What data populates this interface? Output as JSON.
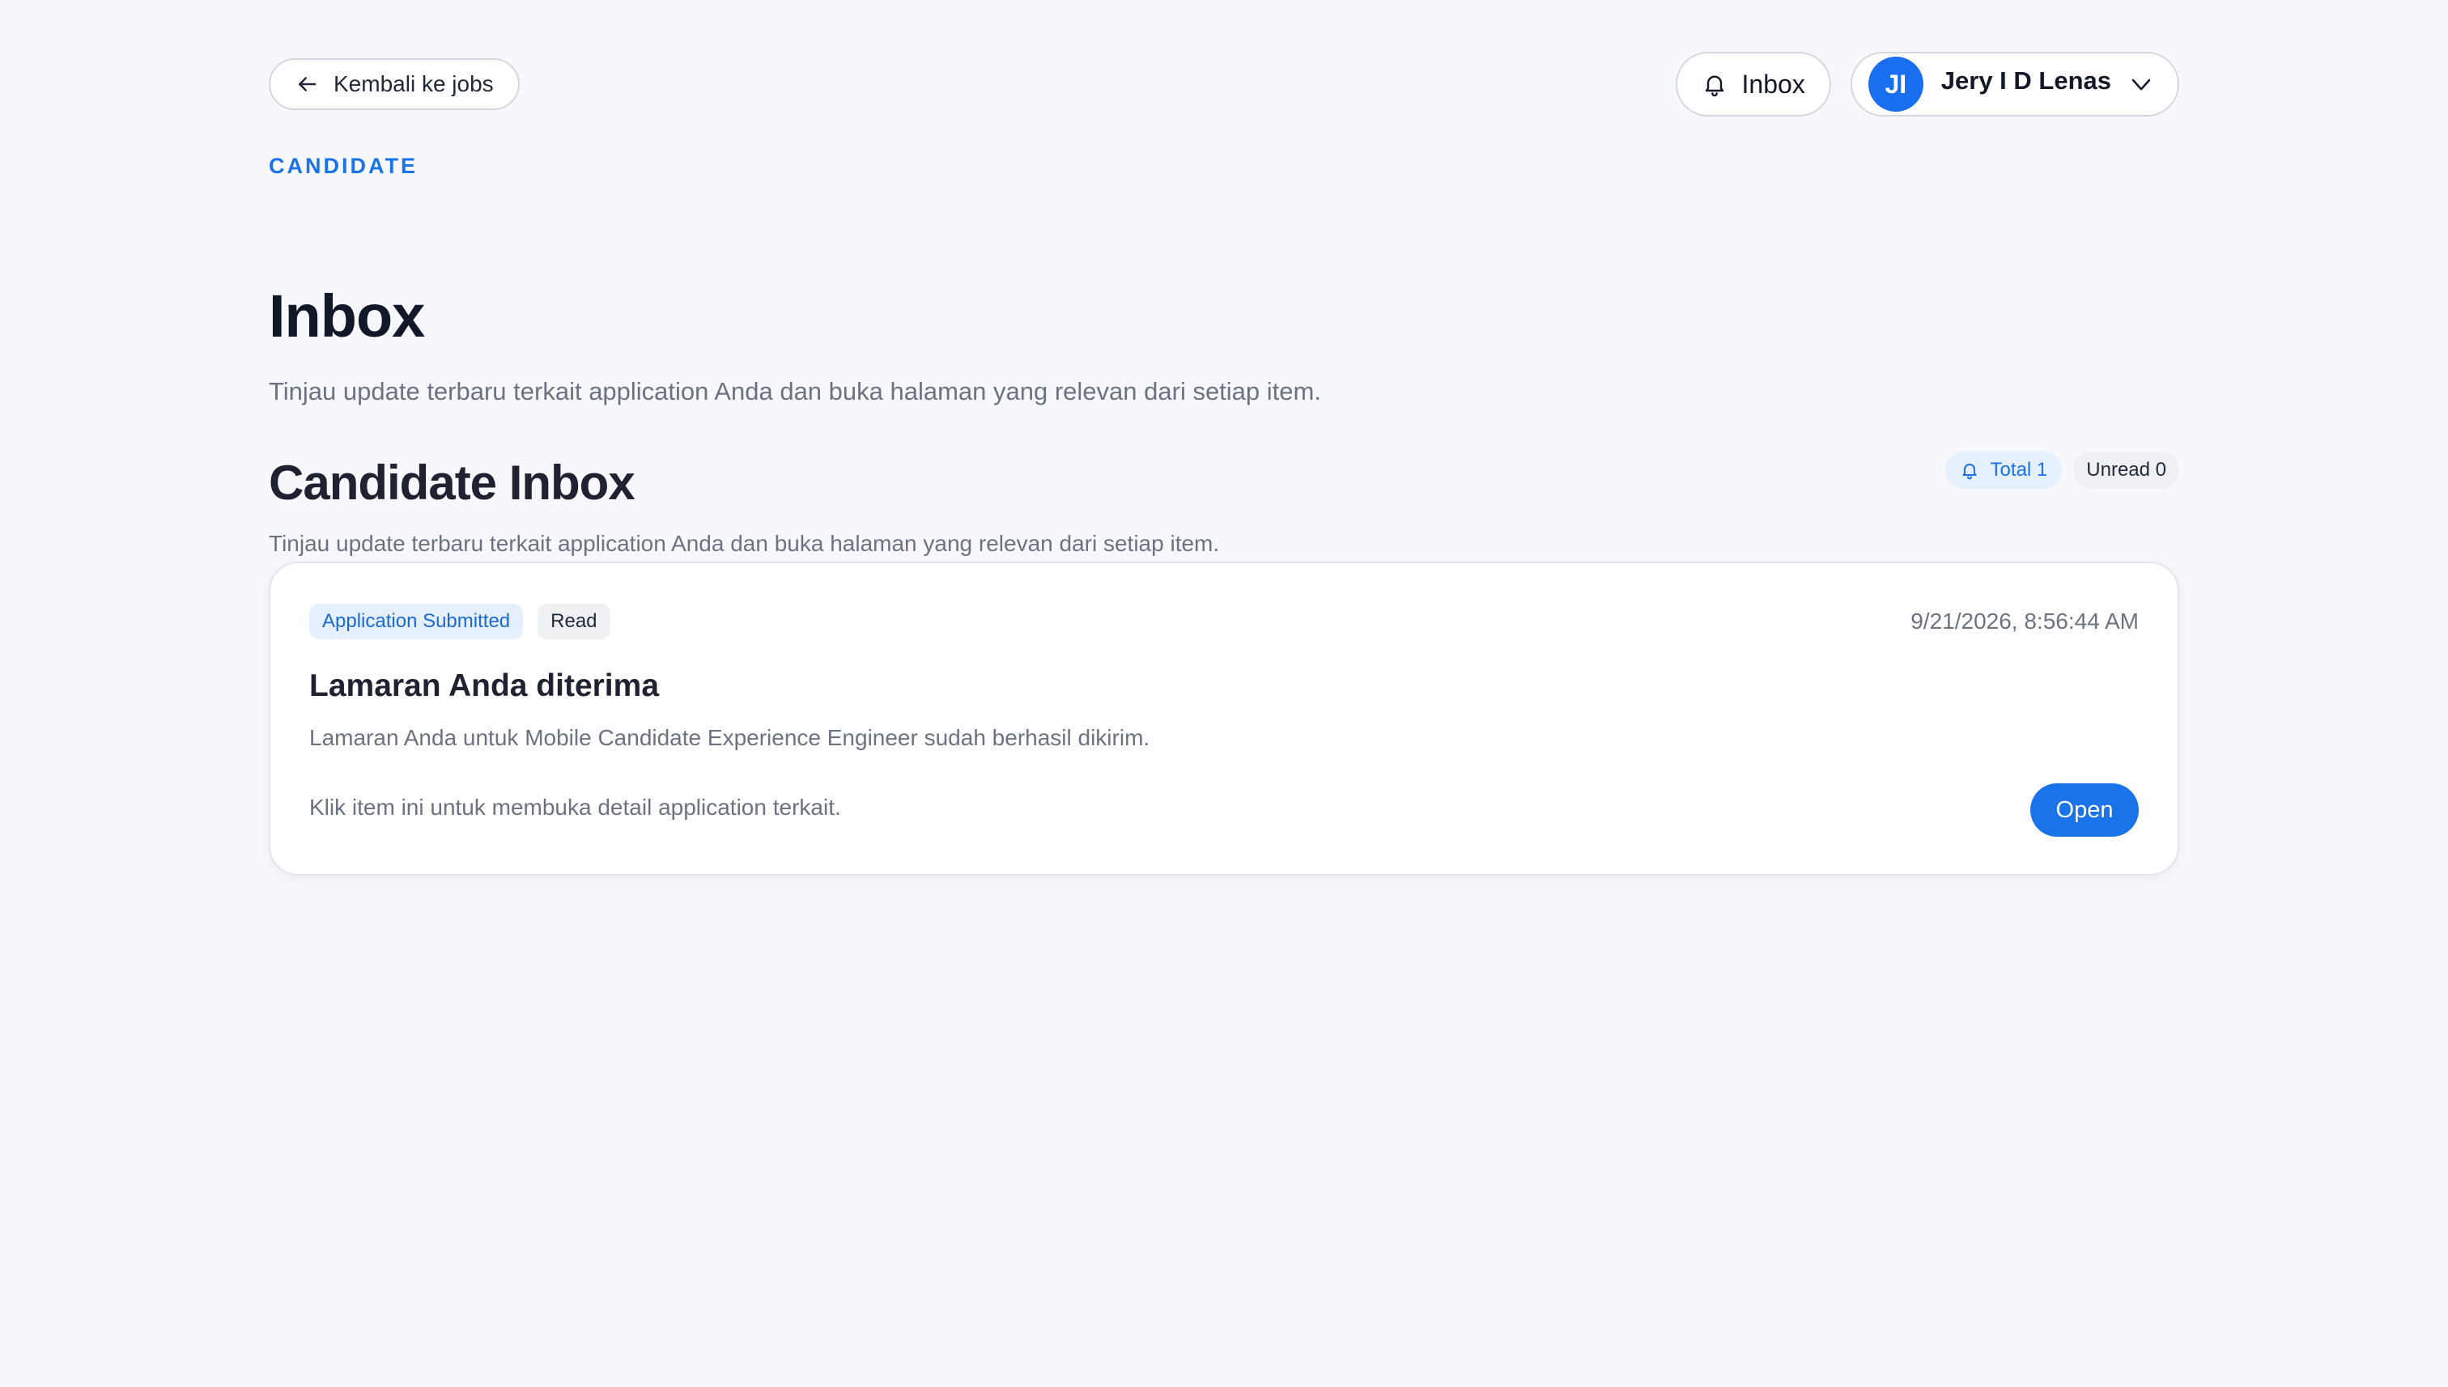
{
  "header": {
    "back_label": "Kembali ke jobs",
    "inbox_label": "Inbox",
    "user": {
      "initials": "JI",
      "name": "Jery I D Lenas"
    }
  },
  "eyebrow": "CANDIDATE",
  "page": {
    "title": "Inbox",
    "subtitle": "Tinjau update terbaru terkait application Anda dan buka halaman yang relevan dari setiap item."
  },
  "section": {
    "title": "Candidate Inbox",
    "subtitle": "Tinjau update terbaru terkait application Anda dan buka halaman yang relevan dari setiap item.",
    "total_label": "Total 1",
    "unread_label": "Unread 0"
  },
  "notifications": [
    {
      "status": "Application Submitted",
      "read_state": "Read",
      "timestamp": "9/21/2026, 8:56:44 AM",
      "title": "Lamaran Anda diterima",
      "description": "Lamaran Anda untuk Mobile Candidate Experience Engineer sudah berhasil dikirim.",
      "hint": "Klik item ini untuk membuka detail application terkait.",
      "open_label": "Open"
    }
  ],
  "colors": {
    "accent": "#1a73e8",
    "background": "#f7f8fb",
    "avatar": "#1a6ef0"
  },
  "icons": {
    "back": "arrow-left-icon",
    "inbox": "bell-icon",
    "user_menu": "chevron-down-icon",
    "total": "bell-icon"
  }
}
